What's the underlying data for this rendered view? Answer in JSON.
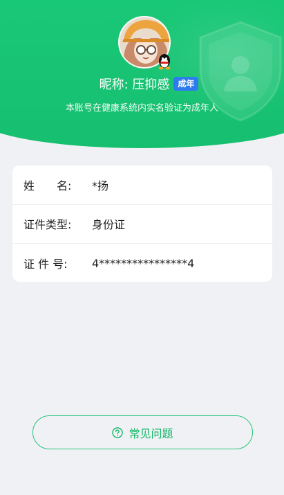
{
  "profile": {
    "nickname": "昵称: 压抑感",
    "adult_badge": "成年",
    "verify_note": "本账号在健康系统内实名验证为成年人"
  },
  "info": {
    "rows": [
      {
        "label": "姓　　名:",
        "value": "*扬"
      },
      {
        "label": "证件类型:",
        "value": "身份证"
      },
      {
        "label": "证 件 号:",
        "value": "4****************4"
      }
    ]
  },
  "faq": {
    "label": "常见问题"
  },
  "colors": {
    "header_green": "#19c877",
    "badge_blue": "#2e7bef",
    "faq_green": "#14b767",
    "background": "#f0f1f5"
  },
  "icons": {
    "shield": "shield-user-icon",
    "qq": "qq-penguin-icon",
    "faq": "question-circle-icon"
  }
}
